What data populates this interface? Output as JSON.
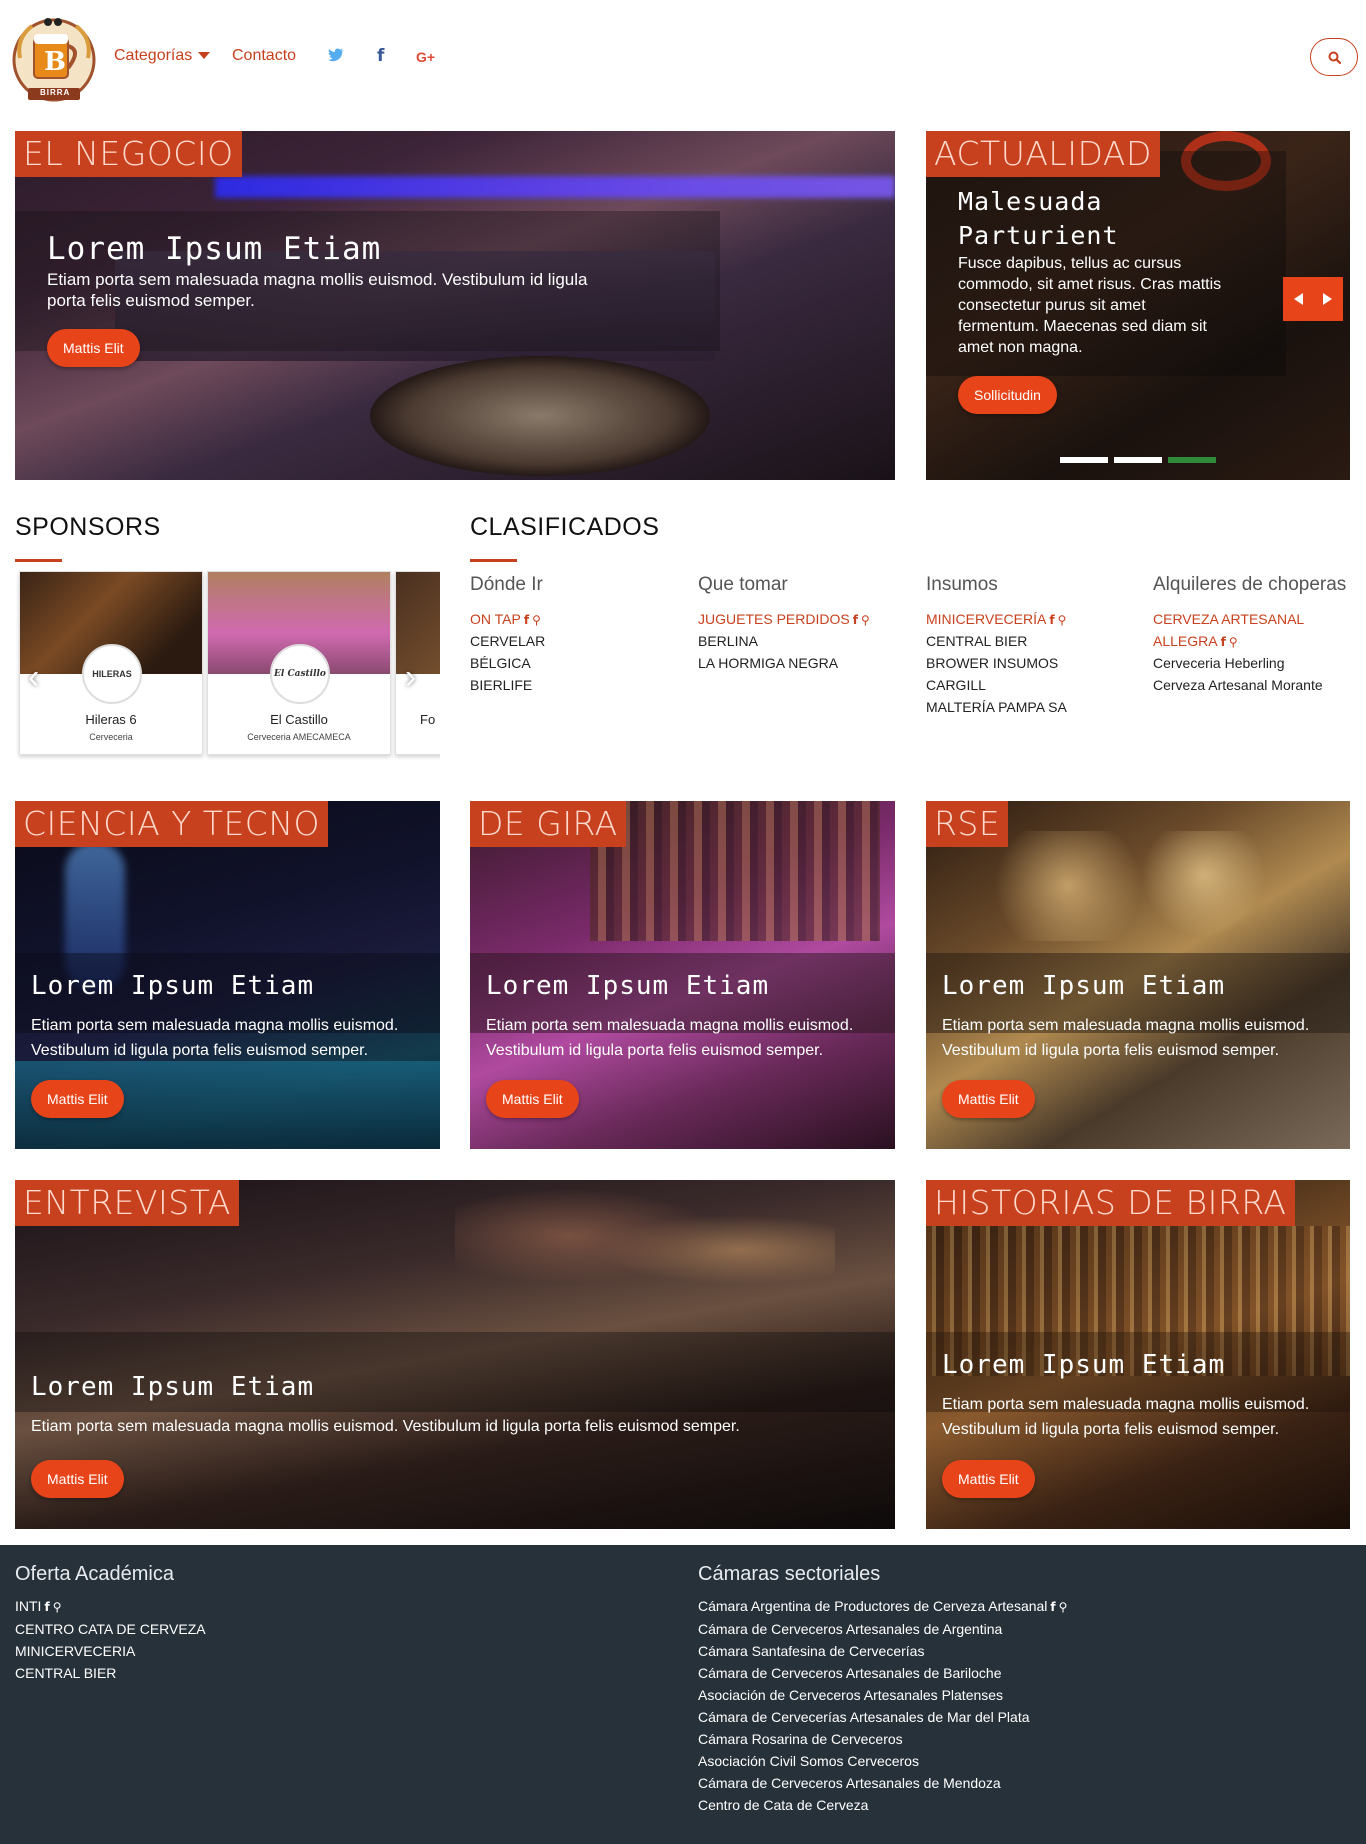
{
  "header": {
    "logo_text": "BIRRA",
    "nav": {
      "categorias": "Categorías",
      "contacto": "Contacto"
    },
    "social": {
      "twitter": "twitter-icon",
      "facebook": "facebook-icon",
      "googleplus": "G+"
    },
    "search_icon": "search-icon"
  },
  "colors": {
    "accent": "#c8411e",
    "button": "#e8441a",
    "footer": "#27313a"
  },
  "hero": {
    "category": "EL NEGOCIO",
    "title": "Lorem Ipsum Etiam",
    "text": "Etiam porta sem malesuada magna mollis euismod. Vestibulum id ligula porta felis euismod semper.",
    "button": "Mattis Elit"
  },
  "news": {
    "category": "ACTUALIDAD",
    "title_line1": "Malesuada",
    "title_line2": "Parturient",
    "text": "Fusce dapibus, tellus ac cursus commodo, sit amet risus. Cras mattis consectetur purus sit amet fermentum. Maecenas sed diam sit amet non magna.",
    "button": "Sollicitudin",
    "prev_icon": "chevron-left-icon",
    "next_icon": "chevron-right-icon",
    "slides": 3,
    "active_slide": 3
  },
  "sponsors": {
    "title": "SPONSORS",
    "items": [
      {
        "logo": "HILERAS",
        "name": "Hileras 6",
        "sub": "Cerveceria"
      },
      {
        "logo": "El Castillo",
        "name": "El Castillo",
        "sub": "Cerveceria AMECAMECA"
      },
      {
        "logo": "",
        "name": "Fo",
        "sub": ""
      }
    ]
  },
  "classifieds": {
    "title": "CLASIFICADOS",
    "columns": [
      {
        "title": "Dónde Ir",
        "items": [
          {
            "text": "ON TAP",
            "highlight": true,
            "icons": true
          },
          {
            "text": "CERVELAR"
          },
          {
            "text": "BÉLGICA"
          },
          {
            "text": "BIERLIFE"
          }
        ]
      },
      {
        "title": "Que tomar",
        "items": [
          {
            "text": "JUGUETES PERDIDOS",
            "highlight": true,
            "icons": true
          },
          {
            "text": "BERLINA"
          },
          {
            "text": "LA HORMIGA NEGRA"
          }
        ]
      },
      {
        "title": "Insumos",
        "items": [
          {
            "text": "MINICERVECERÍA",
            "highlight": true,
            "icons": true
          },
          {
            "text": "CENTRAL BIER"
          },
          {
            "text": "BROWER INSUMOS"
          },
          {
            "text": "CARGILL"
          },
          {
            "text": "MALTERÍA PAMPA SA"
          }
        ]
      },
      {
        "title": "Alquileres de choperas",
        "items": [
          {
            "text": "CERVEZA ARTESANAL",
            "highlight": true
          },
          {
            "text": "ALLEGRA",
            "highlight": true,
            "icons": true
          },
          {
            "text": "Cerveceria Heberling"
          },
          {
            "text": "Cerveza Artesanal Morante"
          }
        ]
      }
    ]
  },
  "cards": [
    {
      "category": "CIENCIA Y TECNO",
      "title": "Lorem Ipsum Etiam",
      "text": "Etiam porta sem malesuada magna mollis euismod. Vestibulum id ligula porta felis euismod semper.",
      "button": "Mattis Elit"
    },
    {
      "category": "DE GIRA",
      "title": "Lorem Ipsum Etiam",
      "text": "Etiam porta sem malesuada magna mollis euismod. Vestibulum id ligula porta felis euismod semper.",
      "button": "Mattis Elit"
    },
    {
      "category": "RSE",
      "title": "Lorem Ipsum Etiam",
      "text": "Etiam porta sem malesuada magna mollis euismod. Vestibulum id ligula porta felis euismod semper.",
      "button": "Mattis Elit"
    },
    {
      "category": "ENTREVISTA",
      "title": "Lorem Ipsum Etiam",
      "text": "Etiam porta sem malesuada magna mollis euismod. Vestibulum id ligula porta felis euismod semper.",
      "button": "Mattis Elit"
    },
    {
      "category": "HISTORIAS DE BIRRA",
      "title": "Lorem Ipsum Etiam",
      "text": "Etiam porta sem malesuada magna mollis euismod. Vestibulum id ligula porta felis euismod semper.",
      "button": "Mattis Elit"
    }
  ],
  "footer": {
    "oferta": {
      "title": "Oferta Académica",
      "items": [
        {
          "text": "INTI",
          "icons": true
        },
        {
          "text": "CENTRO CATA DE CERVEZA"
        },
        {
          "text": "MINICERVECERIA"
        },
        {
          "text": "CENTRAL BIER"
        }
      ]
    },
    "camaras": {
      "title": "Cámaras sectoriales",
      "items": [
        {
          "text": "Cámara Argentina de Productores de Cerveza Artesanal",
          "icons": true
        },
        {
          "text": "Cámara de Cerveceros Artesanales de Argentina"
        },
        {
          "text": "Cámara Santafesina de Cervecerías"
        },
        {
          "text": "Cámara de Cerveceros Artesanales de Bariloche"
        },
        {
          "text": "Asociación de Cerveceros Artesanales Platenses"
        },
        {
          "text": "Cámara de Cervecerías Artesanales de Mar del Plata"
        },
        {
          "text": "Cámara Rosarina de Cerveceros"
        },
        {
          "text": "Asociación Civil Somos Cerveceros"
        },
        {
          "text": "Cámara de Cerveceros Artesanales de Mendoza"
        },
        {
          "text": "Centro de Cata de Cerveza"
        }
      ]
    }
  }
}
